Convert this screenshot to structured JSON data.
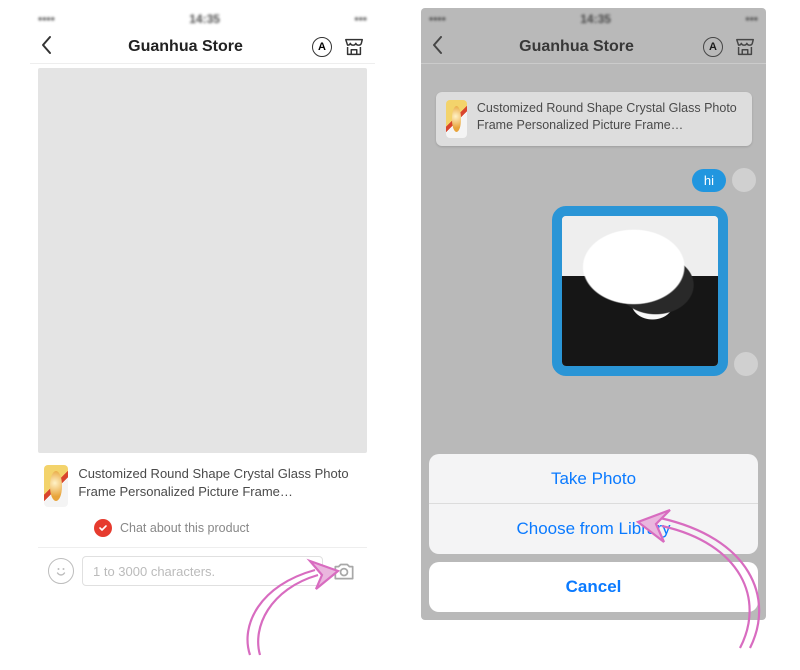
{
  "statusbar": {
    "time": "14:35"
  },
  "nav": {
    "title": "Guanhua Store"
  },
  "product": {
    "title": "Customized Round Shape Crystal Glass Photo Frame Personalized Picture Frame…"
  },
  "left": {
    "chat_hint": "Chat about this product",
    "input_placeholder": "1 to 3000 characters."
  },
  "right": {
    "hi_text": "hi"
  },
  "action_sheet": {
    "take_photo": "Take Photo",
    "choose_library": "Choose from Library",
    "cancel": "Cancel"
  }
}
